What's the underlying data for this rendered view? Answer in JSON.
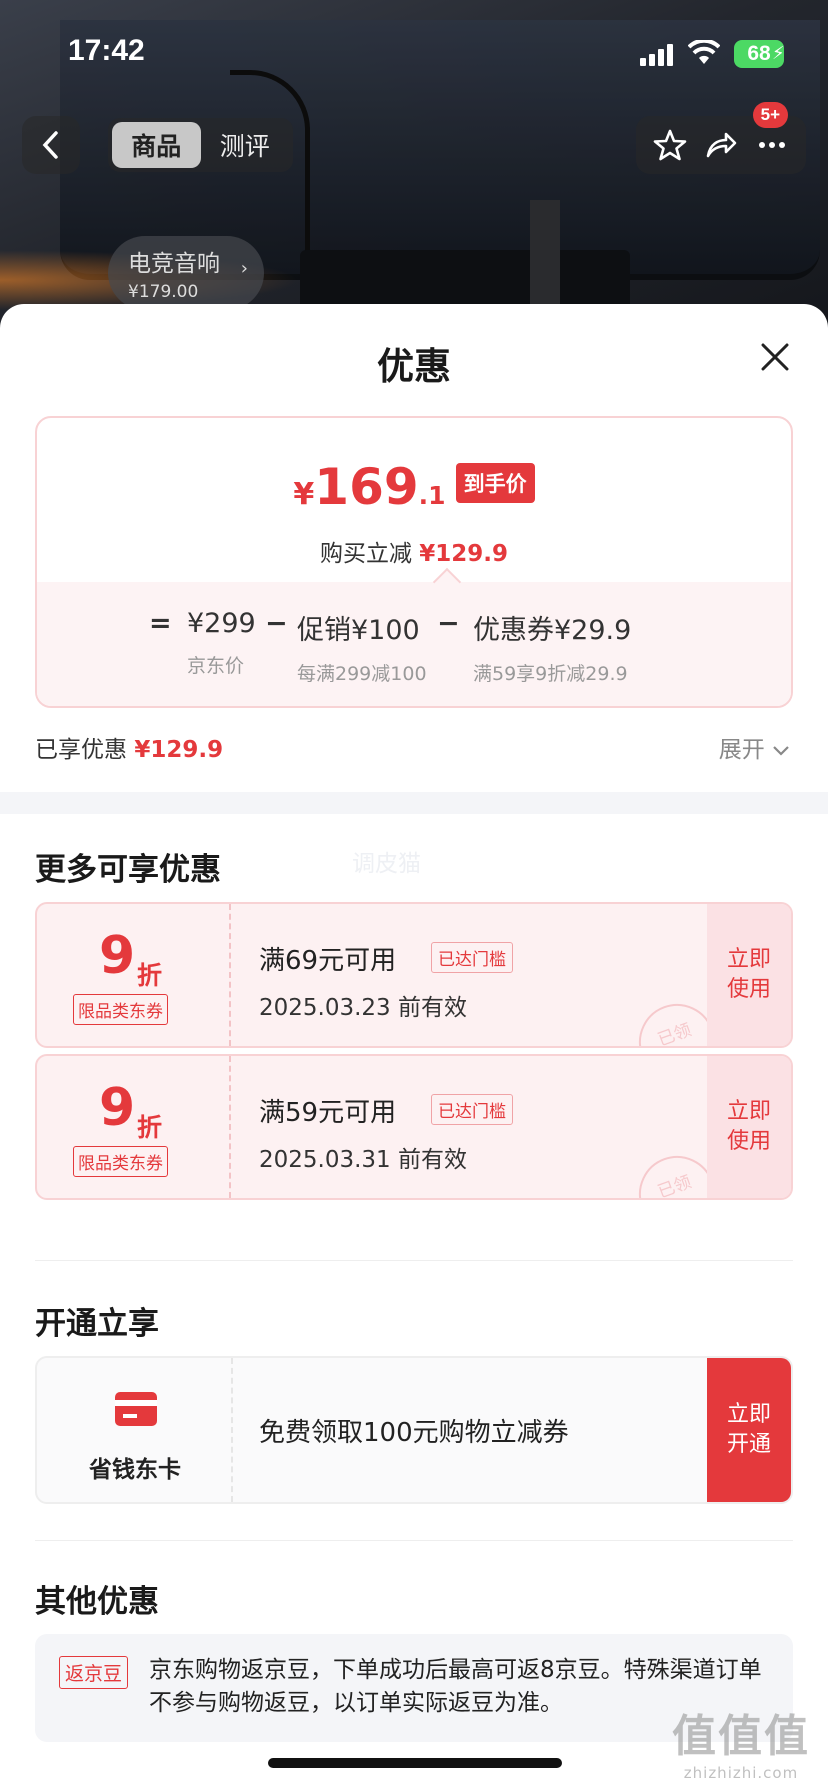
{
  "status_bar": {
    "time": "17:42",
    "battery": "68"
  },
  "nav": {
    "tabs": [
      {
        "label": "商品",
        "active": true
      },
      {
        "label": "测评",
        "active": false
      }
    ],
    "notification_badge": "5+"
  },
  "product_chip": {
    "title": "电竞音响",
    "price": "¥179.00"
  },
  "sheet": {
    "title": "优惠",
    "price_summary": {
      "currency": "¥",
      "final_int": "169",
      "final_dec": ".1",
      "final_tag": "到手价",
      "instant_off_label": "购买立减",
      "instant_off_value": "¥129.9",
      "formula": {
        "equals": "=",
        "minus": "−",
        "jd_price": "¥299",
        "jd_price_label": "京东价",
        "promo": "促销¥100",
        "promo_note": "每满299减100",
        "coupon": "优惠券¥29.9",
        "coupon_note": "满59享9折减29.9"
      }
    },
    "enjoyed_label": "已享优惠",
    "enjoyed_value": "¥129.9",
    "expand_label": "展开",
    "more_title": "更多可享优惠",
    "more_watermark": "调皮猫",
    "coupons": [
      {
        "discount": "9",
        "unit": "折",
        "kind": "限品类东券",
        "condition": "满69元可用",
        "reached": "已达门槛",
        "valid": "2025.03.23 前有效",
        "action": "立即使用",
        "stamp": "已领"
      },
      {
        "discount": "9",
        "unit": "折",
        "kind": "限品类东券",
        "condition": "满59元可用",
        "reached": "已达门槛",
        "valid": "2025.03.31 前有效",
        "action": "立即使用",
        "stamp": "已领"
      }
    ],
    "open_title": "开通立享",
    "membership": {
      "name": "省钱东卡",
      "desc": "免费领取100元购物立减券",
      "action": "立即开通"
    },
    "other_title": "其他优惠",
    "other": {
      "tag": "返京豆",
      "text": "京东购物返京豆，下单成功后最高可返8京豆。特殊渠道订单不参与购物返豆，以订单实际返豆为准。"
    }
  },
  "site_watermark": {
    "line1": "值值值",
    "line2": "zhizhizhi.com"
  },
  "colors": {
    "accent": "#e4393c",
    "card_bg": "#fdf1f2",
    "border_pink": "#f8d2d4"
  }
}
